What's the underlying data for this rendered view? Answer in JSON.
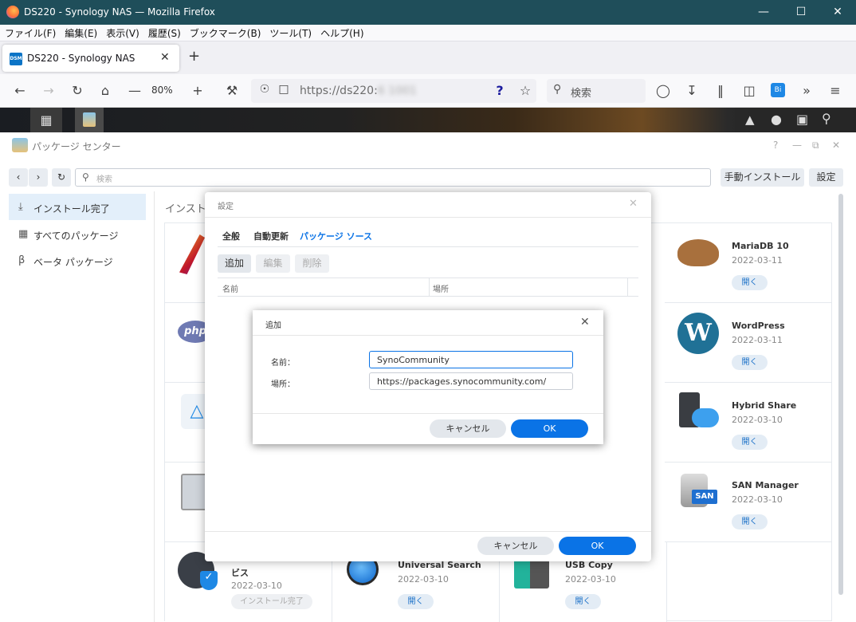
{
  "browser": {
    "title": "DS220 - Synology NAS — Mozilla Firefox",
    "menu": [
      "ファイル(F)",
      "編集(E)",
      "表示(V)",
      "履歴(S)",
      "ブックマーク(B)",
      "ツール(T)",
      "ヘルプ(H)"
    ],
    "tab_title": "DS220 - Synology NAS",
    "tab_favicon": "DSM",
    "zoom": "80%",
    "url": "https://ds220:",
    "url_masked": "6 1001",
    "search_placeholder": "検索",
    "ext_badge": "Bi"
  },
  "window": {
    "title": "パッケージ センター",
    "search_placeholder": "検索",
    "manual_install": "手動インストール",
    "settings": "設定"
  },
  "sidebar": {
    "items": [
      {
        "label": "インストール完了",
        "icon": "download-icon"
      },
      {
        "label": "すべてのパッケージ",
        "icon": "grid-icon"
      },
      {
        "label": "ベータ パッケージ",
        "icon": "beta-icon"
      }
    ]
  },
  "section_heading": "インストー",
  "packages": [
    {
      "name": "MariaDB 10",
      "date": "2022-03-11",
      "action": "開く"
    },
    {
      "name": "WordPress",
      "date": "2022-03-11",
      "action": "開く"
    },
    {
      "name": "Hybrid Share",
      "date": "2022-03-10",
      "action": "開く"
    },
    {
      "name": "SAN Manager",
      "date": "2022-03-10",
      "action": "開く"
    },
    {
      "name": "ビス",
      "date": "2022-03-10",
      "action": "インストール完了"
    },
    {
      "name": "Universal Search",
      "date": "2022-03-10",
      "action": "開く"
    },
    {
      "name": "USB Copy",
      "date": "2022-03-10",
      "action": "開く"
    }
  ],
  "settings_dialog": {
    "title": "設定",
    "tabs": [
      "全般",
      "自動更新",
      "パッケージ ソース"
    ],
    "active_tab": 2,
    "buttons": {
      "add": "追加",
      "edit": "編集",
      "delete": "削除"
    },
    "columns": [
      "名前",
      "場所"
    ],
    "cancel": "キャンセル",
    "ok": "OK"
  },
  "add_dialog": {
    "title": "追加",
    "name_label": "名前：",
    "name_value": "SynoCommunity",
    "location_label": "場所：",
    "location_value": "https://packages.synocommunity.com/",
    "cancel": "キャンセル",
    "ok": "OK"
  },
  "colors": {
    "accent": "#0a73e6",
    "titlebar": "#1f4e5a"
  }
}
